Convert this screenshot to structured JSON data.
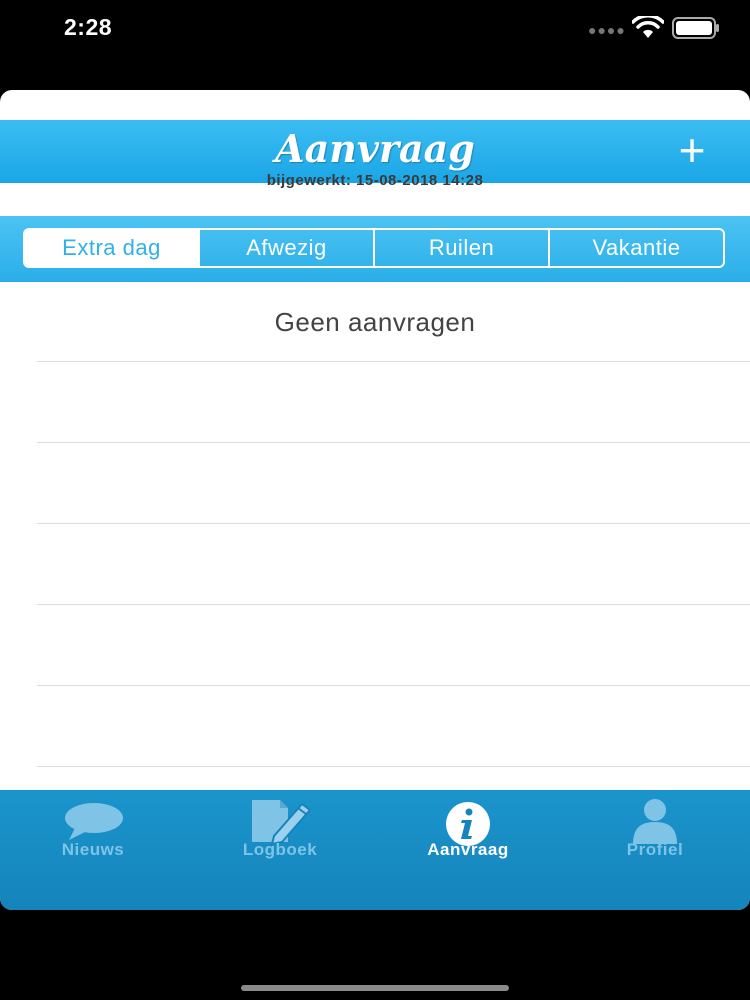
{
  "status_bar": {
    "time": "2:28"
  },
  "header": {
    "title": "Aanvraag",
    "updated": "bijgewerkt: 15-08-2018 14:28",
    "add_label": "+"
  },
  "segments": [
    {
      "label": "Extra dag",
      "selected": true
    },
    {
      "label": "Afwezig",
      "selected": false
    },
    {
      "label": "Ruilen",
      "selected": false
    },
    {
      "label": "Vakantie",
      "selected": false
    }
  ],
  "list": {
    "empty_text": "Geen aanvragen"
  },
  "tabs": [
    {
      "label": "Nieuws",
      "icon": "chat-bubble-icon",
      "active": false
    },
    {
      "label": "Logboek",
      "icon": "document-pencil-icon",
      "active": false
    },
    {
      "label": "Aanvraag",
      "icon": "info-icon",
      "active": true
    },
    {
      "label": "Profiel",
      "icon": "person-icon",
      "active": false
    }
  ],
  "colors": {
    "header_blue": "#1aa6e6",
    "segment_blue": "#2fb1e9",
    "tab_bar_blue": "#1584bb",
    "inactive_tab": "#7fc4e6"
  }
}
